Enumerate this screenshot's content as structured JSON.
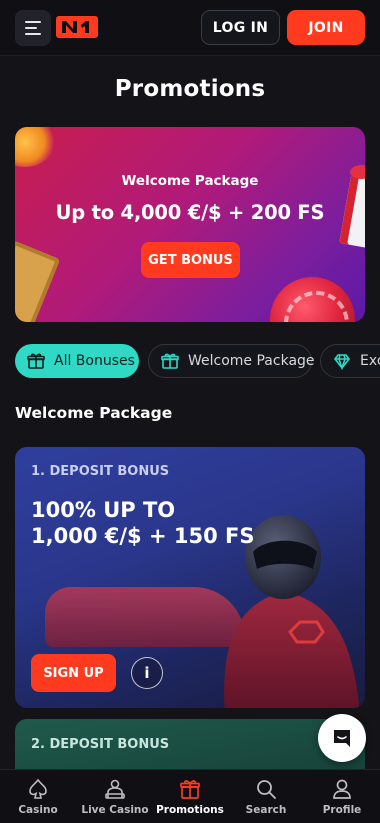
{
  "header": {
    "login_label": "LOG IN",
    "join_label": "JOIN",
    "logo_text": "N1"
  },
  "page": {
    "title": "Promotions"
  },
  "hero": {
    "subtitle": "Welcome Package",
    "title": "Up to 4,000 €/$ + 200 FS",
    "button_label": "GET BONUS"
  },
  "filters": [
    {
      "label": "All Bonuses",
      "icon": "gift-icon",
      "active": true
    },
    {
      "label": "Welcome Package",
      "icon": "gift-icon",
      "active": false
    },
    {
      "label": "Exc",
      "icon": "diamond-icon",
      "active": false
    }
  ],
  "section": {
    "title": "Welcome Package"
  },
  "bonus_cards": [
    {
      "step": "1. DEPOSIT BONUS",
      "headline_line1": "100% UP TO",
      "headline_line2": "1,000 €/$ + 150 FS",
      "button_label": "SIGN UP",
      "info_label": "i"
    },
    {
      "step": "2. DEPOSIT BONUS"
    }
  ],
  "bottom_nav": [
    {
      "label": "Casino",
      "icon": "spade-icon",
      "active": false
    },
    {
      "label": "Live Casino",
      "icon": "dealer-icon",
      "active": false
    },
    {
      "label": "Promotions",
      "icon": "gift-icon",
      "active": true
    },
    {
      "label": "Search",
      "icon": "search-icon",
      "active": false
    },
    {
      "label": "Profile",
      "icon": "user-icon",
      "active": false
    }
  ],
  "colors": {
    "accent": "#ff3a1f",
    "teal": "#2fd9c6",
    "background": "#141418"
  }
}
